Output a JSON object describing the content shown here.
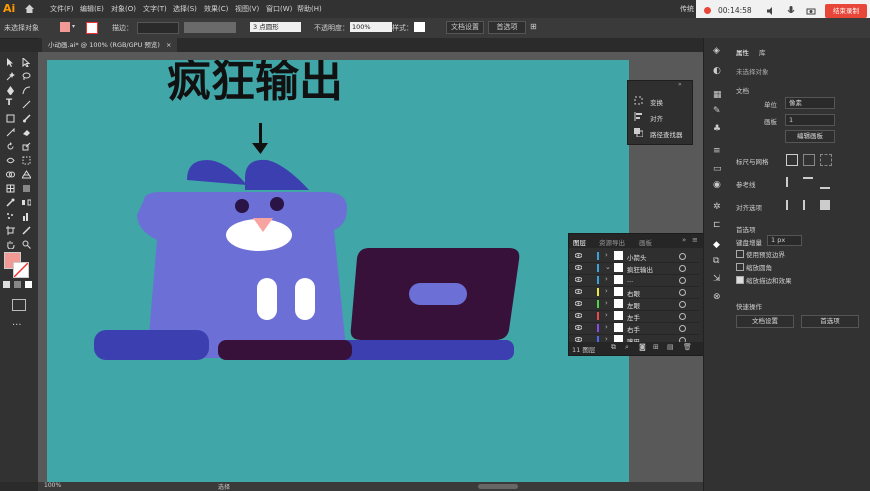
{
  "app": {
    "logo": "Ai",
    "menus": [
      "文件(F)",
      "编辑(E)",
      "对象(O)",
      "文字(T)",
      "选择(S)",
      "效果(C)",
      "视图(V)",
      "窗口(W)",
      "帮助(H)"
    ],
    "top_right_text": "传统"
  },
  "recording": {
    "time": "00:14:58",
    "stop_label": "结束录制"
  },
  "control_bar": {
    "selection_status": "未选择对象",
    "stroke_label": "描边：",
    "stroke_profile": "3 点圆形",
    "opacity_label": "不透明度：",
    "opacity_value": "100%",
    "style_label": "样式：",
    "doc_setup": "文档设置",
    "preferences": "首选项"
  },
  "doc_tab": {
    "title": "小动画.ai* @ 100% (RGB/GPU 预览)",
    "close": "×"
  },
  "canvas": {
    "headline": "疯狂输出",
    "zoom": "100%",
    "status_tool": "选择"
  },
  "float_panel": {
    "items": [
      "变换",
      "对齐",
      "路径查找器"
    ]
  },
  "layers_panel": {
    "tabs": [
      "图层",
      "资源导出",
      "画板"
    ],
    "layers": [
      {
        "name": "小箭头",
        "color": "#3aa3d8",
        "expanded": false
      },
      {
        "name": "疯狂输出",
        "color": "#3aa3d8",
        "expanded": true
      },
      {
        "name": "...",
        "color": "#3aa3d8",
        "expanded": false
      },
      {
        "name": "右眼",
        "color": "#e8e84a",
        "expanded": false
      },
      {
        "name": "左眼",
        "color": "#4ad84a",
        "expanded": false
      },
      {
        "name": "左手",
        "color": "#e84a4a",
        "expanded": false
      },
      {
        "name": "右手",
        "color": "#8a4ae8",
        "expanded": false
      },
      {
        "name": "嘴巴",
        "color": "#4a6ae8",
        "expanded": false
      }
    ],
    "footer_count": "11 图层"
  },
  "properties_panel": {
    "tabs": [
      "属性",
      "库"
    ],
    "status": "未选择对象",
    "doc_section": "文档",
    "unit_label": "单位",
    "unit_value": "像素",
    "artboard_label": "画板",
    "artboard_value": "1",
    "edit_artboard": "编辑画板",
    "rulers_grid": "标尺与网格",
    "guides": "参考线",
    "align_to": "对齐选项",
    "preferences_section": "首选项",
    "keyboard_increment_label": "键盘增量",
    "keyboard_increment_value": "1 px",
    "check1": "使用预览边界",
    "check2": "缩放圆角",
    "check3": "缩放描边和效果",
    "quick_actions": "快速操作",
    "doc_setup_btn": "文档设置",
    "preferences_btn": "首选项"
  }
}
